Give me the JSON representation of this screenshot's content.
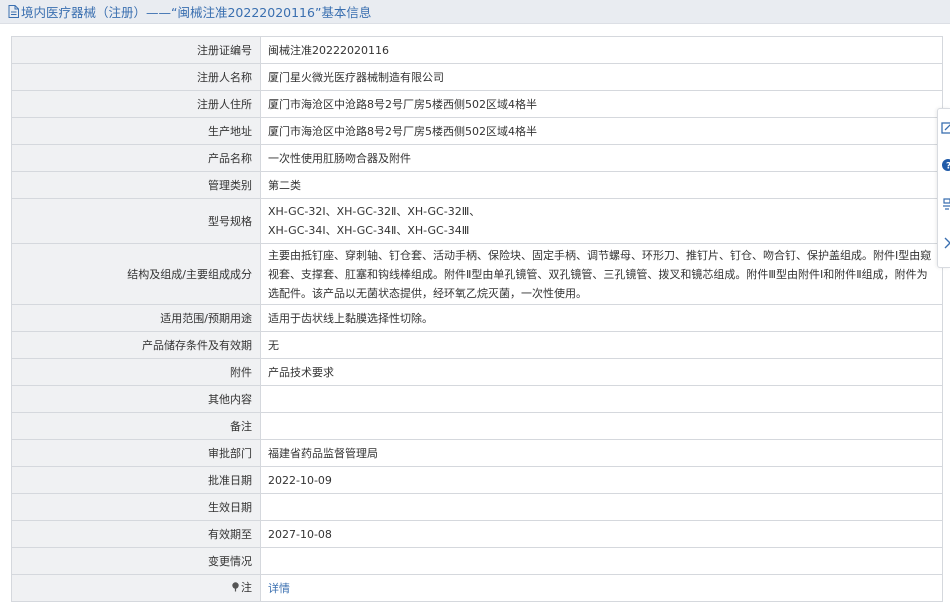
{
  "header": {
    "title": "境内医疗器械（注册）——“闽械注准20222020116”基本信息"
  },
  "rows": [
    {
      "label": "注册证编号",
      "value": "闽械注准20222020116"
    },
    {
      "label": "注册人名称",
      "value": "厦门星火微光医疗器械制造有限公司"
    },
    {
      "label": "注册人住所",
      "value": "厦门市海沧区中沧路8号2号厂房5楼西侧502区域4格半"
    },
    {
      "label": "生产地址",
      "value": "厦门市海沧区中沧路8号2号厂房5楼西侧502区域4格半"
    },
    {
      "label": "产品名称",
      "value": "一次性使用肛肠吻合器及附件"
    },
    {
      "label": "管理类别",
      "value": "第二类"
    },
    {
      "label": "型号规格",
      "value": "XH-GC-32Ⅰ、XH-GC-32Ⅱ、XH-GC-32Ⅲ、\nXH-GC-34Ⅰ、XH-GC-34Ⅱ、XH-GC-34Ⅲ"
    },
    {
      "label": "结构及组成/主要组成成分",
      "value": "主要由抵钉座、穿刺轴、钉仓套、活动手柄、保险块、固定手柄、调节螺母、环形刀、推钉片、钉仓、吻合钉、保护盖组成。附件Ⅰ型由窥视套、支撑套、肛塞和钩线棒组成。附件Ⅱ型由单孔镜管、双孔镜管、三孔镜管、拨叉和镜芯组成。附件Ⅲ型由附件Ⅰ和附件Ⅱ组成，附件为选配件。该产品以无菌状态提供，经环氧乙烷灭菌，一次性使用。"
    },
    {
      "label": "适用范围/预期用途",
      "value": "适用于齿状线上黏膜选择性切除。"
    },
    {
      "label": "产品储存条件及有效期",
      "value": "无"
    },
    {
      "label": "附件",
      "value": "产品技术要求"
    },
    {
      "label": "其他内容",
      "value": ""
    },
    {
      "label": "备注",
      "value": ""
    },
    {
      "label": "审批部门",
      "value": "福建省药品监督管理局"
    },
    {
      "label": "批准日期",
      "value": "2022-10-09"
    },
    {
      "label": "生效日期",
      "value": ""
    },
    {
      "label": "有效期至",
      "value": "2027-10-08"
    },
    {
      "label": "变更情况",
      "value": ""
    }
  ],
  "note": {
    "label": "注",
    "link": "详情"
  },
  "icons": {
    "header": "document-icon",
    "note": "pin-icon",
    "sidebar": [
      "edit-icon",
      "help-icon",
      "share-icon",
      "expand-icon"
    ]
  },
  "colors": {
    "accent": "#3a6fb0",
    "header_bg": "#e9ecf1",
    "label_bg": "#f0f1f3",
    "border": "#d5d8dd"
  }
}
